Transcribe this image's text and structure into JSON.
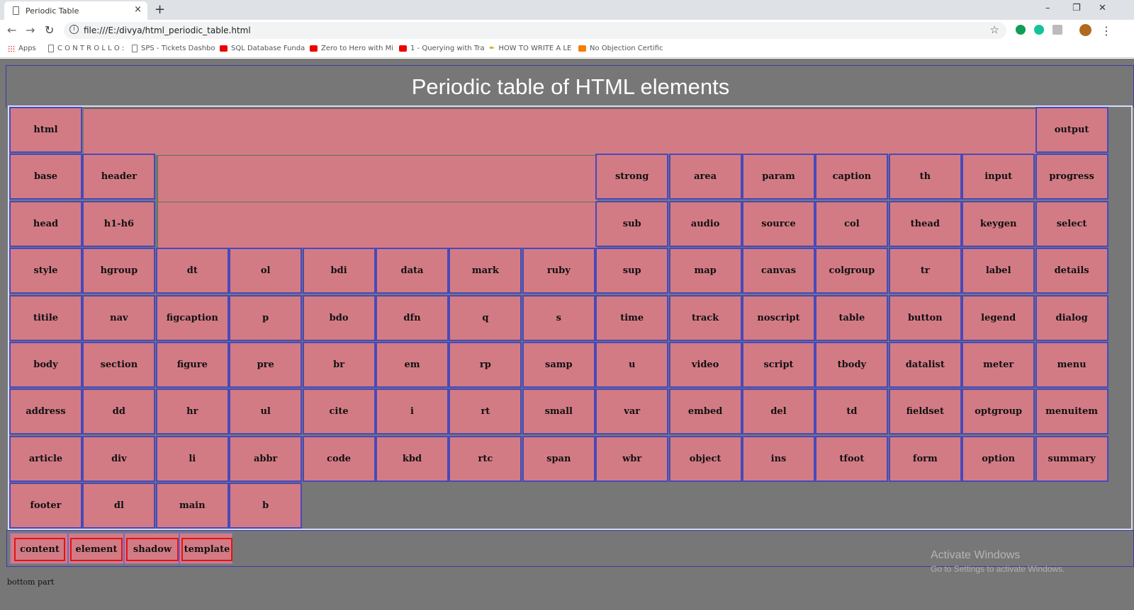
{
  "browser": {
    "tab_title": "Periodic Table",
    "new_tab": "+",
    "close_tab": "×",
    "url": "file:///E:/divya/html_periodic_table.html",
    "window": {
      "minimize": "–",
      "restore": "❐",
      "close": "✕"
    },
    "bookmarks": [
      {
        "label": "Apps",
        "icon": "apps-grid-icon"
      },
      {
        "label": "C O N T R O L L O :",
        "icon": "page-icon"
      },
      {
        "label": "SPS - Tickets Dashbo",
        "icon": "page-icon"
      },
      {
        "label": "SQL Database Funda",
        "icon": "youtube-icon"
      },
      {
        "label": "Zero to Hero with Mi",
        "icon": "youtube-icon"
      },
      {
        "label": "1 - Querying with Tra",
        "icon": "youtube-icon"
      },
      {
        "label": "HOW TO WRITE A LE",
        "icon": "pen-icon"
      },
      {
        "label": "No Objection Certific",
        "icon": "blogger-icon"
      }
    ]
  },
  "page": {
    "title": "Periodic table of HTML elements",
    "rows": [
      [
        "html",
        "output"
      ],
      [
        "base",
        "header",
        "strong",
        "area",
        "param",
        "caption",
        "th",
        "input",
        "progress"
      ],
      [
        "head",
        "h1-h6",
        "sub",
        "audio",
        "source",
        "col",
        "thead",
        "keygen",
        "select"
      ],
      [
        "style",
        "hgroup",
        "dt",
        "ol",
        "bdi",
        "data",
        "mark",
        "ruby",
        "sup",
        "map",
        "canvas",
        "colgroup",
        "tr",
        "label",
        "details"
      ],
      [
        "titile",
        "nav",
        "figcaption",
        "p",
        "bdo",
        "dfn",
        "q",
        "s",
        "time",
        "track",
        "noscript",
        "table",
        "button",
        "legend",
        "dialog"
      ],
      [
        "body",
        "section",
        "figure",
        "pre",
        "br",
        "em",
        "rp",
        "samp",
        "u",
        "video",
        "script",
        "tbody",
        "datalist",
        "meter",
        "menu"
      ],
      [
        "address",
        "dd",
        "hr",
        "ul",
        "cite",
        "i",
        "rt",
        "small",
        "var",
        "embed",
        "del",
        "td",
        "fieldset",
        "optgroup",
        "menuitem"
      ],
      [
        "article",
        "div",
        "li",
        "abbr",
        "code",
        "kbd",
        "rtc",
        "span",
        "wbr",
        "object",
        "ins",
        "tfoot",
        "form",
        "option",
        "summary"
      ],
      [
        "footer",
        "dl",
        "main",
        "b"
      ]
    ],
    "web_components": [
      "content",
      "element",
      "shadow",
      "template"
    ],
    "bottom_text": "bottom part",
    "watermark": {
      "line1": "Activate Windows",
      "line2": "Go to Settings to activate Windows."
    }
  },
  "colors": {
    "page_bg": "#777777",
    "cell_bg": "#d37b85",
    "cell_border": "#4949b8",
    "highlight_border": "#e31414"
  }
}
